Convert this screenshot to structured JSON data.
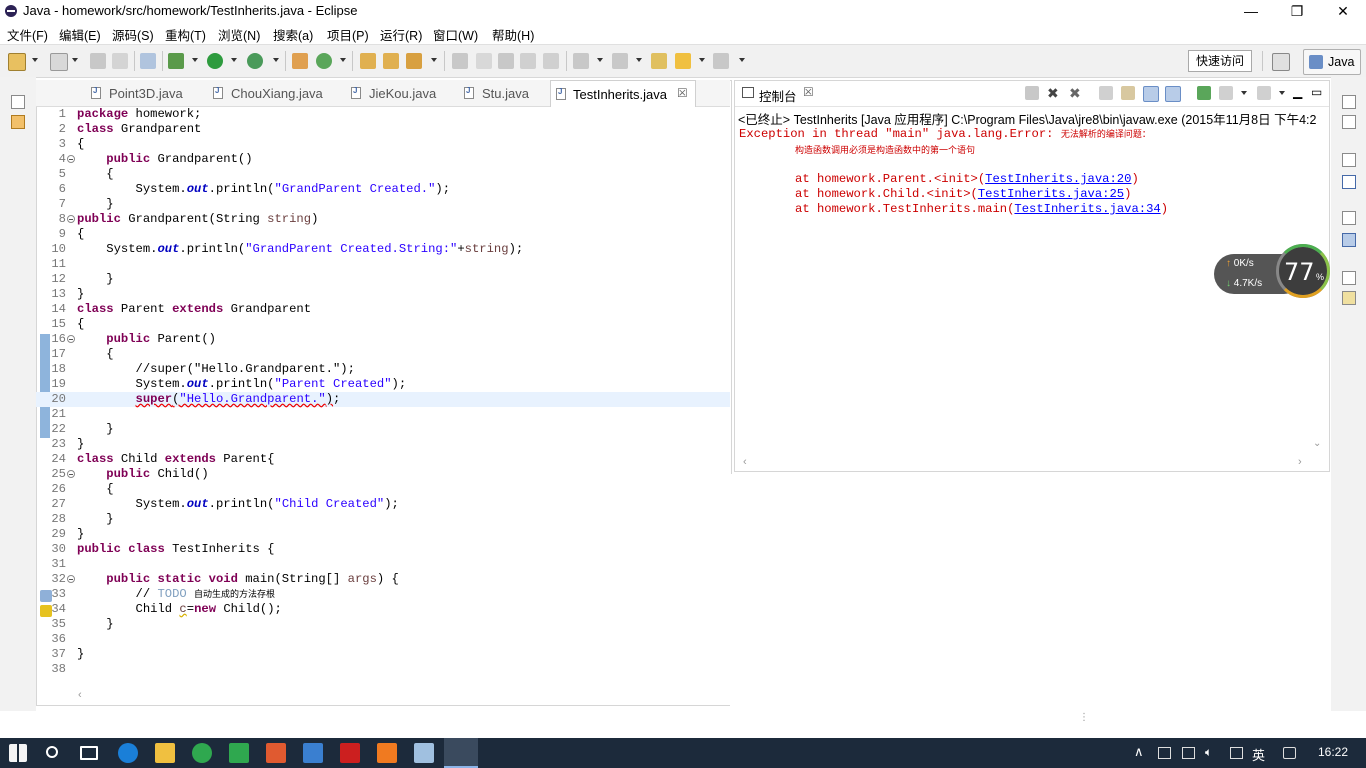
{
  "window": {
    "title": "Java - homework/src/homework/TestInherits.java - Eclipse",
    "controls": [
      "—",
      "❐",
      "✕"
    ]
  },
  "menu": [
    "文件(F)",
    "编辑(E)",
    "源码(S)",
    "重构(T)",
    "浏览(N)",
    "搜索(a)",
    "项目(P)",
    "运行(R)",
    "窗口(W)",
    "帮助(H)"
  ],
  "toolbar": {
    "quick_access": "快速访问",
    "perspective": "Java"
  },
  "editor": {
    "tabs": [
      {
        "label": "Point3D.java",
        "active": false
      },
      {
        "label": "ChouXiang.java",
        "active": false
      },
      {
        "label": "JieKou.java",
        "active": false
      },
      {
        "label": "Stu.java",
        "active": false
      },
      {
        "label": "TestInherits.java",
        "active": true
      }
    ],
    "close_glyph": "☒",
    "code": [
      {
        "n": "1",
        "t": "package homework;"
      },
      {
        "n": "2",
        "t": "class Grandparent"
      },
      {
        "n": "3",
        "t": "{"
      },
      {
        "n": "4",
        "t": "    public Grandparent()"
      },
      {
        "n": "5",
        "t": "    {"
      },
      {
        "n": "6",
        "t": "        System.out.println(\"GrandParent Created.\");"
      },
      {
        "n": "7",
        "t": "    }"
      },
      {
        "n": "8",
        "t": "public Grandparent(String string)"
      },
      {
        "n": "9",
        "t": "{"
      },
      {
        "n": "10",
        "t": "    System.out.println(\"GrandParent Created.String:\"+string);"
      },
      {
        "n": "11",
        "t": ""
      },
      {
        "n": "12",
        "t": "    }"
      },
      {
        "n": "13",
        "t": "}"
      },
      {
        "n": "14",
        "t": "class Parent extends Grandparent"
      },
      {
        "n": "15",
        "t": "{"
      },
      {
        "n": "16",
        "t": "    public Parent()"
      },
      {
        "n": "17",
        "t": "    {"
      },
      {
        "n": "18",
        "t": "        //super(\"Hello.Grandparent.\");"
      },
      {
        "n": "19",
        "t": "        System.out.println(\"Parent Created\");"
      },
      {
        "n": "20",
        "t": "        super(\"Hello.Grandparent.\");"
      },
      {
        "n": "21",
        "t": ""
      },
      {
        "n": "22",
        "t": "    }"
      },
      {
        "n": "23",
        "t": "}"
      },
      {
        "n": "24",
        "t": "class Child extends Parent{"
      },
      {
        "n": "25",
        "t": "    public Child()"
      },
      {
        "n": "26",
        "t": "    {"
      },
      {
        "n": "27",
        "t": "        System.out.println(\"Child Created\");"
      },
      {
        "n": "28",
        "t": "    }"
      },
      {
        "n": "29",
        "t": "}"
      },
      {
        "n": "30",
        "t": "public class TestInherits {"
      },
      {
        "n": "31",
        "t": ""
      },
      {
        "n": "32",
        "t": "    public static void main(String[] args) {"
      },
      {
        "n": "33",
        "t": "        // TODO 自动生成的方法存根"
      },
      {
        "n": "34",
        "t": "        Child c=new Child();"
      },
      {
        "n": "35",
        "t": "    }"
      },
      {
        "n": "36",
        "t": ""
      },
      {
        "n": "37",
        "t": "}"
      },
      {
        "n": "38",
        "t": ""
      }
    ],
    "current_line": "20"
  },
  "console": {
    "tab_label": "控制台",
    "status": "<已终止> TestInherits [Java 应用程序] C:\\Program Files\\Java\\jre8\\bin\\javaw.exe (2015年11月8日 下午4:2",
    "error_prefix": "Exception in thread \"main\" java.lang.Error: ",
    "error_msg1": "无法解析的编译问题：",
    "error_msg2": "构造函数调用必须是构造函数中的第一个语句",
    "trace": [
      {
        "prefix": "at homework.Parent.<init>(",
        "link": "TestInherits.java:20",
        "suffix": ")"
      },
      {
        "prefix": "at homework.Child.<init>(",
        "link": "TestInherits.java:25",
        "suffix": ")"
      },
      {
        "prefix": "at homework.TestInherits.main(",
        "link": "TestInherits.java:34",
        "suffix": ")"
      }
    ]
  },
  "net_widget": {
    "up": "0K/s",
    "down": "4.7K/s",
    "percent": "77",
    "percent_sign": "%"
  },
  "taskbar": {
    "lang": "英",
    "time": "16:22"
  },
  "colors": {
    "keyword": "#7f0055",
    "string": "#2a00ff",
    "comment": "#3f7f5f",
    "error": "#cc0000",
    "link": "#0000ff",
    "taskbar": "#1c2a3b"
  }
}
